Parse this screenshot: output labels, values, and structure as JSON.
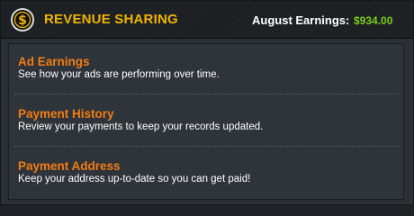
{
  "header": {
    "title": "REVENUE SHARING",
    "logo_icon": "dollar-coin-icon",
    "earnings_label": "August Earnings:",
    "earnings_value": "$934.00"
  },
  "colors": {
    "title": "#f0b400",
    "earnings_value": "#7ccd1a",
    "item_title": "#f27d12",
    "item_desc": "#ffffff"
  },
  "items": [
    {
      "title": "Ad Earnings",
      "description": "See how your ads are performing over time."
    },
    {
      "title": "Payment History",
      "description": "Review your payments to keep your records updated."
    },
    {
      "title": "Payment Address",
      "description": "Keep your address up-to-date so you can get paid!"
    }
  ]
}
